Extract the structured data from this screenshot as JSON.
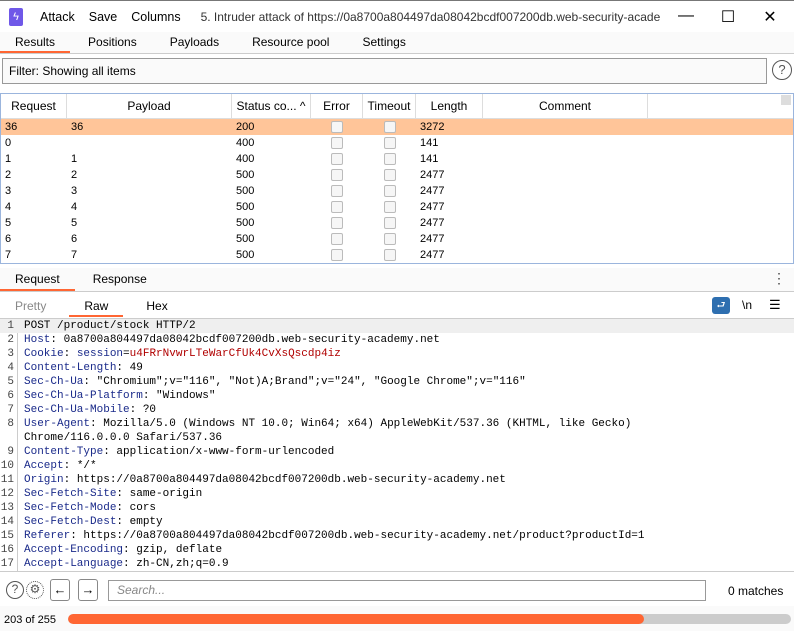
{
  "titlebar": {
    "menu": [
      "Attack",
      "Save",
      "Columns"
    ],
    "title": "5. Intruder attack of https://0a8700a804497da08042bcdf007200db.web-security-acade...",
    "minimize": "—",
    "maximize": "☐",
    "close": "✕"
  },
  "tabs": [
    "Results",
    "Positions",
    "Payloads",
    "Resource pool",
    "Settings"
  ],
  "filter": "Filter: Showing all items",
  "table": {
    "columns": [
      "Request",
      "Payload",
      "Status co... ^",
      "Error",
      "Timeout",
      "Length",
      "Comment"
    ],
    "rows": [
      [
        "36",
        "36",
        "200",
        "3272"
      ],
      [
        "0",
        "",
        "400",
        "141"
      ],
      [
        "1",
        "1",
        "400",
        "141"
      ],
      [
        "2",
        "2",
        "500",
        "2477"
      ],
      [
        "3",
        "3",
        "500",
        "2477"
      ],
      [
        "4",
        "4",
        "500",
        "2477"
      ],
      [
        "5",
        "5",
        "500",
        "2477"
      ],
      [
        "6",
        "6",
        "500",
        "2477"
      ],
      [
        "7",
        "7",
        "500",
        "2477"
      ]
    ]
  },
  "rr_tabs": [
    "Request",
    "Response"
  ],
  "sub_tabs": [
    "Pretty",
    "Raw",
    "Hex"
  ],
  "editor_tools": {
    "newline": "\\n"
  },
  "request_lines": [
    {
      "n": "1",
      "k": "",
      "v": "POST /product/stock HTTP/2"
    },
    {
      "n": "2",
      "k": "Host",
      "v": "0a8700a804497da08042bcdf007200db.web-security-academy.net"
    },
    {
      "n": "3",
      "k": "Cookie",
      "ck": "session",
      "v": "u4FRrNvwrLTeWarCfUk4CvXsQscdp4iz"
    },
    {
      "n": "4",
      "k": "Content-Length",
      "v": "49"
    },
    {
      "n": "5",
      "k": "Sec-Ch-Ua",
      "v": "\"Chromium\";v=\"116\", \"Not)A;Brand\";v=\"24\", \"Google Chrome\";v=\"116\""
    },
    {
      "n": "6",
      "k": "Sec-Ch-Ua-Platform",
      "v": "\"Windows\""
    },
    {
      "n": "7",
      "k": "Sec-Ch-Ua-Mobile",
      "v": "?0"
    },
    {
      "n": "8",
      "k": "User-Agent",
      "v": "Mozilla/5.0 (Windows NT 10.0; Win64; x64) AppleWebKit/537.36 (KHTML, like Gecko)"
    },
    {
      "n": "",
      "k": "",
      "v": "Chrome/116.0.0.0 Safari/537.36"
    },
    {
      "n": "9",
      "k": "Content-Type",
      "v": "application/x-www-form-urlencoded"
    },
    {
      "n": "10",
      "k": "Accept",
      "v": "*/*"
    },
    {
      "n": "11",
      "k": "Origin",
      "v": "https://0a8700a804497da08042bcdf007200db.web-security-academy.net"
    },
    {
      "n": "12",
      "k": "Sec-Fetch-Site",
      "v": "same-origin"
    },
    {
      "n": "13",
      "k": "Sec-Fetch-Mode",
      "v": "cors"
    },
    {
      "n": "14",
      "k": "Sec-Fetch-Dest",
      "v": "empty"
    },
    {
      "n": "15",
      "k": "Referer",
      "v": "https://0a8700a804497da08042bcdf007200db.web-security-academy.net/product?productId=1"
    },
    {
      "n": "16",
      "k": "Accept-Encoding",
      "v": "gzip, deflate"
    },
    {
      "n": "17",
      "k": "Accept-Language",
      "v": "zh-CN,zh;q=0.9"
    }
  ],
  "search": {
    "placeholder": "Search...",
    "matches": "0 matches"
  },
  "progress": {
    "label": "203 of 255",
    "done": 203,
    "total": 255
  },
  "colors": {
    "accent": "#ff6633",
    "selected_row": "#ffc599",
    "logo": "#6f58e8"
  }
}
